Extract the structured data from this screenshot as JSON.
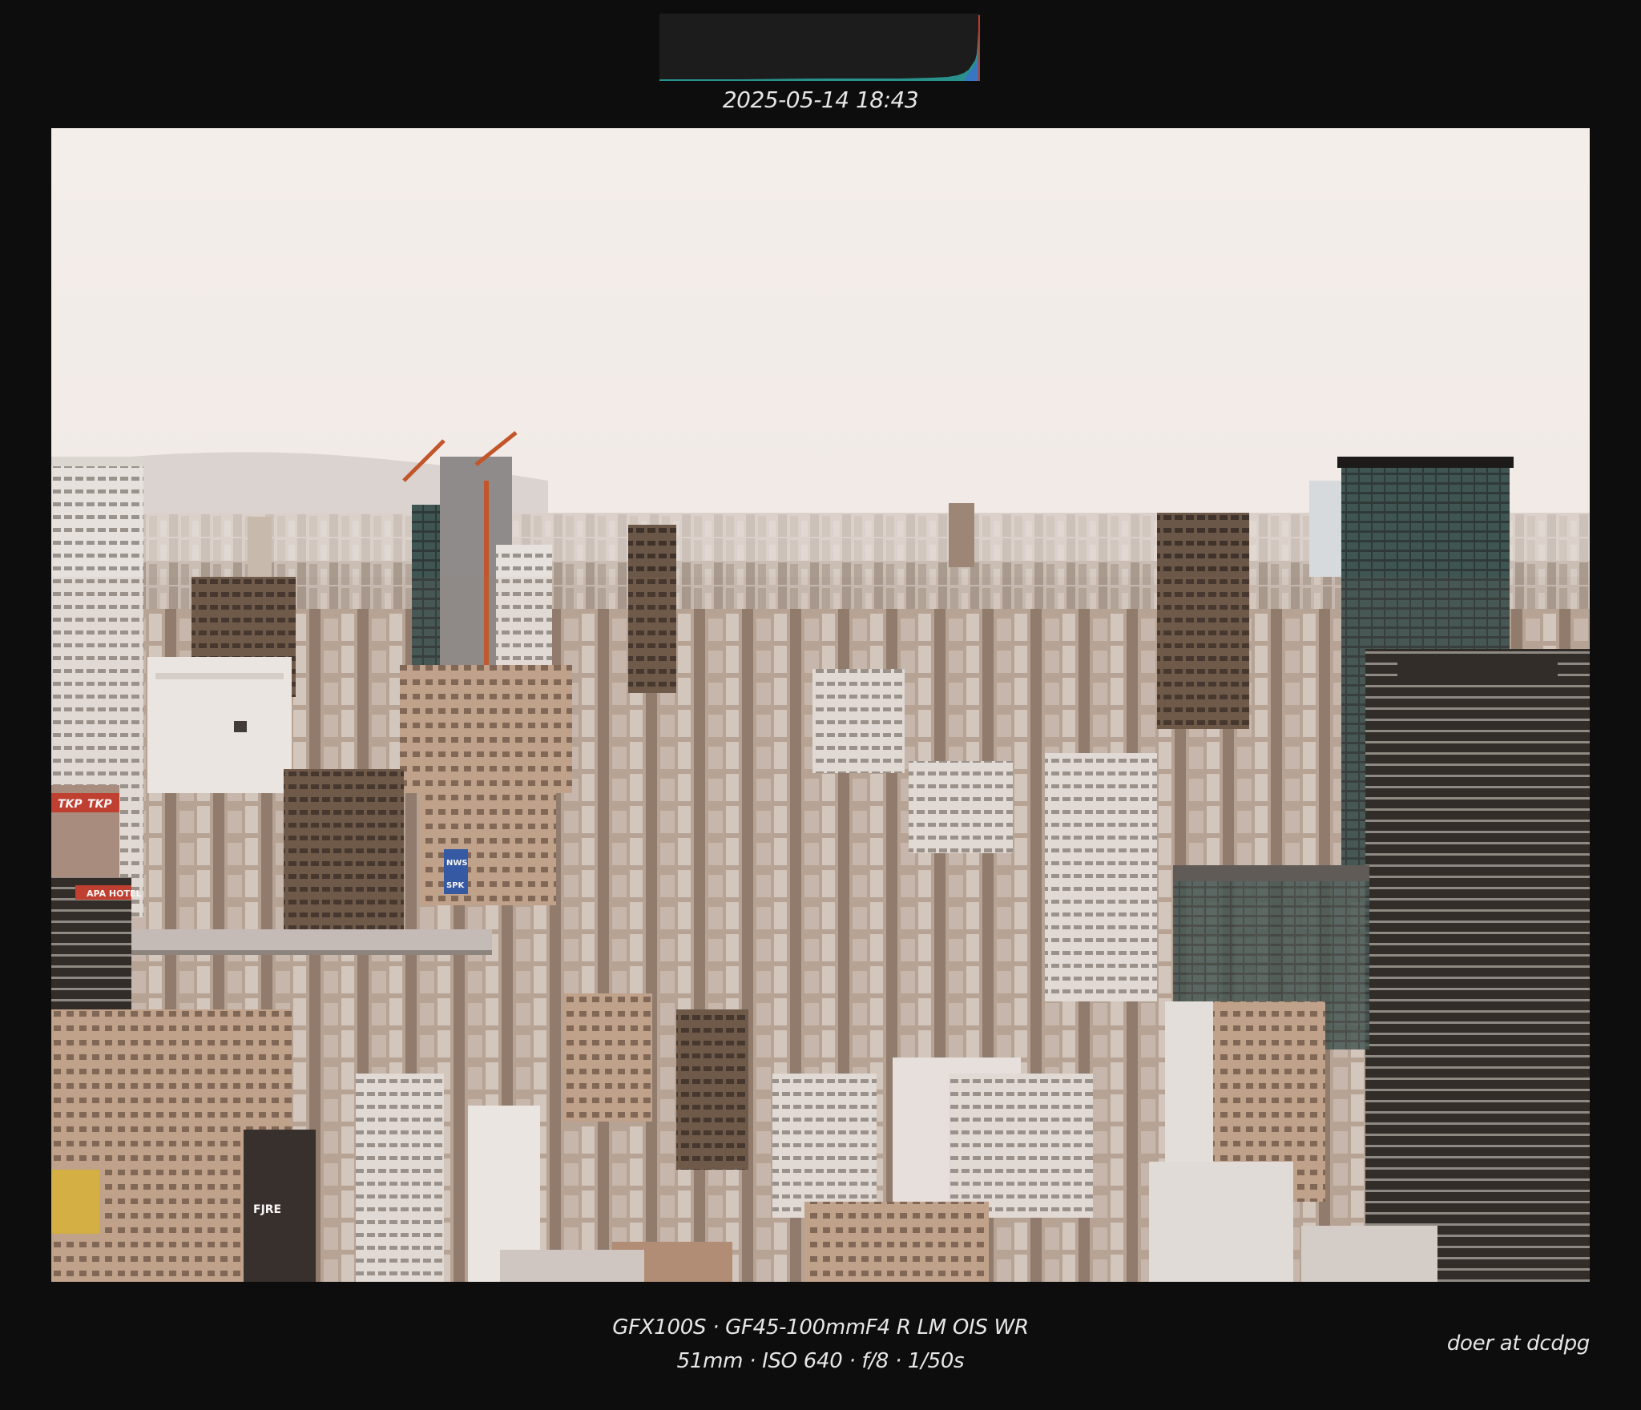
{
  "capture": {
    "timestamp": "2025-05-14 18:43"
  },
  "exif": {
    "camera_and_lens": "GFX100S · GF45-100mmF4 R LM OIS WR",
    "settings": "51mm · ISO 640 · f/8 · 1/50s"
  },
  "credit": "doer at dcdpg",
  "photo": {
    "subject": "city-skyline",
    "signs": {
      "tkp_left": "TKP",
      "tkp_right": "TKP",
      "apa_hotel": "APA HOTEL",
      "nws": "NWS",
      "spk": "SPK",
      "fjre": "FJRE"
    }
  },
  "colors": {
    "frame": "#0d0d0d",
    "sky_top": "#f3ede9",
    "sky_horizon": "#e8e2de",
    "building_tan": "#b99a83",
    "building_dark": "#2a2724",
    "building_light": "#e4e0dc"
  }
}
